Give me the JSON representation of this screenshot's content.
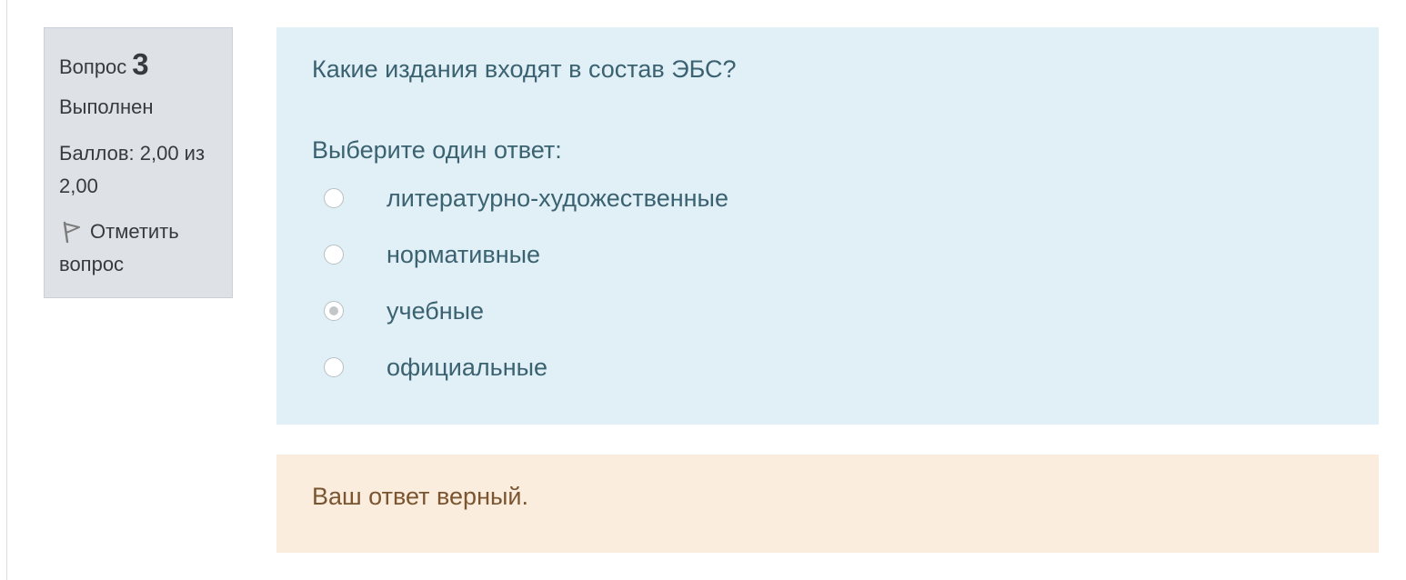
{
  "info": {
    "question_word": "Вопрос",
    "question_number": "3",
    "state": "Выполнен",
    "grade_line1": "Баллов: 2,00 из",
    "grade_line2": "2,00",
    "flag_line1": "Отметить",
    "flag_line2": "вопрос"
  },
  "question": {
    "text": "Какие издания входят в состав ЭБС?",
    "prompt": "Выберите один ответ:",
    "answers": [
      {
        "label": "литературно-художественные",
        "checked": false
      },
      {
        "label": "нормативные",
        "checked": false
      },
      {
        "label": "учебные",
        "checked": true
      },
      {
        "label": "официальные",
        "checked": false
      }
    ]
  },
  "feedback": {
    "text": "Ваш ответ верный."
  },
  "colors": {
    "info_bg": "#dee2e6",
    "content_bg": "#e1eff7",
    "content_text": "#3a6270",
    "feedback_bg": "#fbeddd",
    "feedback_text": "#7a5530"
  },
  "icons": {
    "flag": "flag-icon"
  }
}
